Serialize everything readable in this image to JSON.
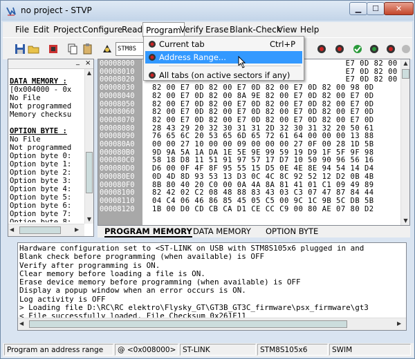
{
  "window": {
    "title": "no project - STVP",
    "minimize": "▁",
    "maximize": "☐",
    "close": "✕"
  },
  "menu": [
    "File",
    "Edit",
    "Project",
    "Configure",
    "Read",
    "Program",
    "Verify",
    "Erase",
    "Blank-Check",
    "View",
    "Help"
  ],
  "toolbar": {
    "device_label": "STM8S"
  },
  "program_menu": {
    "item1": "Current tab",
    "item1_shortcut": "Ctrl+P",
    "item2": "Address Range...",
    "item3": "All tabs (on active sectors if any)"
  },
  "left_panel": {
    "lines": [
      {
        "t": "DATA MEMORY :",
        "h": true
      },
      {
        "t": "[0x004000 - 0x",
        "h": false
      },
      {
        "t": "No File",
        "h": false
      },
      {
        "t": "Not programmed",
        "h": false
      },
      {
        "t": "Memory checksu",
        "h": false
      },
      {
        "t": "",
        "h": false
      },
      {
        "t": "OPTION BYTE :",
        "h": true
      },
      {
        "t": "No File",
        "h": false
      },
      {
        "t": "Not programmed",
        "h": false
      },
      {
        "t": "Option byte 0:",
        "h": false
      },
      {
        "t": "Option byte 1:",
        "h": false
      },
      {
        "t": "Option byte 2:",
        "h": false
      },
      {
        "t": "Option byte 3:",
        "h": false
      },
      {
        "t": "Option byte 4:",
        "h": false
      },
      {
        "t": "Option byte 5:",
        "h": false
      },
      {
        "t": "Option byte 6:",
        "h": false
      },
      {
        "t": "Option byte 7:",
        "h": false
      },
      {
        "t": "Option byte 8:",
        "h": false
      }
    ]
  },
  "hex": {
    "rows": [
      [
        "00008000",
        "                                         E7 0D 82 00 E7 0D"
      ],
      [
        "00008010",
        "                                         E7 0D 82 00 E7 0D"
      ],
      [
        "00008020",
        "                                         E7 0D 82 00 E7 0D"
      ],
      [
        "00008030",
        "82 00 E7 0D 82 00 E7 0D 82 00 E7 0D 82 00 98 0D"
      ],
      [
        "00008040",
        "82 00 E7 0D 82 00 8A 9E 82 00 E7 0D 82 00 E7 0D"
      ],
      [
        "00008050",
        "82 00 E7 0D 82 00 E7 0D 82 00 E7 0D 82 00 E7 0D"
      ],
      [
        "00008060",
        "82 00 E7 0D 82 00 E7 0D 82 00 E7 0D 82 00 E7 0D"
      ],
      [
        "00008070",
        "82 00 E7 0D 82 00 E7 0D 82 00 E7 0D 82 00 E7 0D"
      ],
      [
        "00008080",
        "28 43 29 20 32 30 31 31 2D 32 30 31 32 20 50 61"
      ],
      [
        "00008090",
        "76 65 6C 20 53 65 6D 65 72 61 64 00 00 00 13 88"
      ],
      [
        "000080A0",
        "00 00 27 10 00 00 09 00 00 00 27 0F 00 28 1D 5B"
      ],
      [
        "000080B0",
        "9D 9A 5A 1A DA 1E 5E 9E 99 59 19 D9 1F 5F 9F 98"
      ],
      [
        "000080C0",
        "58 18 D8 11 51 91 97 57 17 D7 10 50 90 96 56 16"
      ],
      [
        "000080D0",
        "D6 00 0F 4F 8F 95 55 15 D5 0E 4E 8E 94 54 14 D4"
      ],
      [
        "000080E0",
        "0D 4D 8D 93 53 13 D3 0C 4C 8C 92 52 12 D2 0B 4B"
      ],
      [
        "000080F0",
        "8B 80 40 20 C0 00 0A 4A 8A 81 41 01 C1 09 49 89"
      ],
      [
        "00008100",
        "82 42 02 C2 08 48 88 83 43 03 C3 07 47 87 84 44"
      ],
      [
        "00008110",
        "04 C4 06 46 86 85 45 05 C5 00 9C 1C 9B 5C DB 5B"
      ],
      [
        "00008120",
        "1B 00 D0 CD CB CA D1 CE CC C9 00 80 AE 07 80 D2"
      ]
    ]
  },
  "tabs": {
    "program_memory": "PROGRAM MEMORY",
    "data_memory": "DATA MEMORY",
    "option_byte": "OPTION BYTE"
  },
  "log": [
    "Hardware configuration set to <ST-LINK on USB with STM8S105x6 plugged in and",
    "Blank check before programming (when available) is OFF",
    "Verify after programming is ON.",
    "Clear memory before loading a file is ON.",
    "Erase device memory before programming (when available) is OFF",
    "Display a popup window when an error occurs is ON.",
    "Log activity is OFF",
    "> Loading file D:\\RC\\RC elektro\\Flysky_GT\\GT3B_GT3C_firmware\\psx_firmware\\gt3",
    "< File successfully loaded. File Checksum 0x261F11"
  ],
  "status": {
    "hint": "Program an address range",
    "address": "@ <0x008000>",
    "probe": "ST-LINK",
    "device": "STM8S105x6",
    "protocol": "SWIM"
  }
}
